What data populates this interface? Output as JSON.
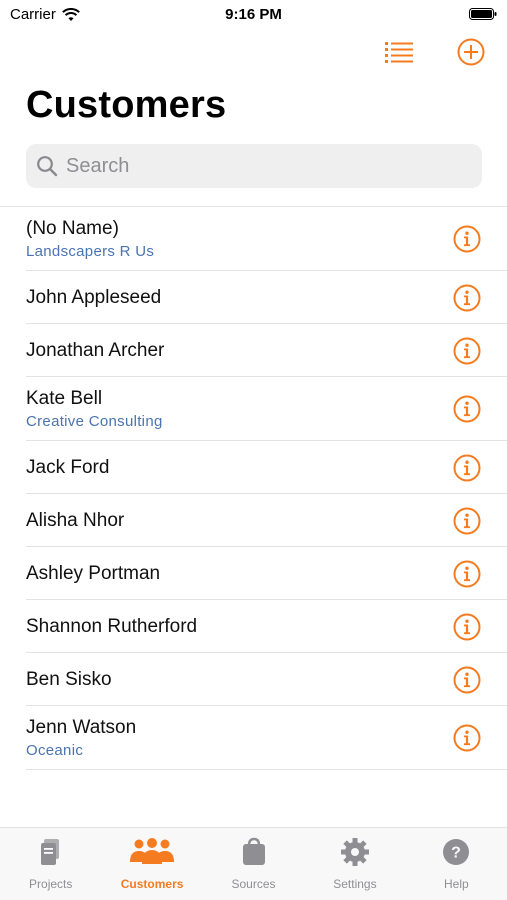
{
  "status_bar": {
    "carrier": "Carrier",
    "time": "9:16 PM"
  },
  "header": {
    "title": "Customers"
  },
  "search": {
    "placeholder": "Search"
  },
  "colors": {
    "accent": "#f47b20",
    "company_text": "#4a74b0",
    "inactive_tab": "#8e8e93"
  },
  "customers": [
    {
      "name": "(No Name)",
      "company": "Landscapers R Us"
    },
    {
      "name": "John Appleseed",
      "company": ""
    },
    {
      "name": "Jonathan Archer",
      "company": ""
    },
    {
      "name": "Kate Bell",
      "company": "Creative Consulting"
    },
    {
      "name": "Jack Ford",
      "company": ""
    },
    {
      "name": "Alisha Nhor",
      "company": ""
    },
    {
      "name": "Ashley Portman",
      "company": ""
    },
    {
      "name": "Shannon Rutherford",
      "company": ""
    },
    {
      "name": "Ben Sisko",
      "company": ""
    },
    {
      "name": "Jenn Watson",
      "company": "Oceanic"
    }
  ],
  "tabs": [
    {
      "label": "Projects",
      "icon": "documents-icon",
      "active": false
    },
    {
      "label": "Customers",
      "icon": "people-icon",
      "active": true
    },
    {
      "label": "Sources",
      "icon": "bag-icon",
      "active": false
    },
    {
      "label": "Settings",
      "icon": "gear-icon",
      "active": false
    },
    {
      "label": "Help",
      "icon": "help-icon",
      "active": false
    }
  ]
}
